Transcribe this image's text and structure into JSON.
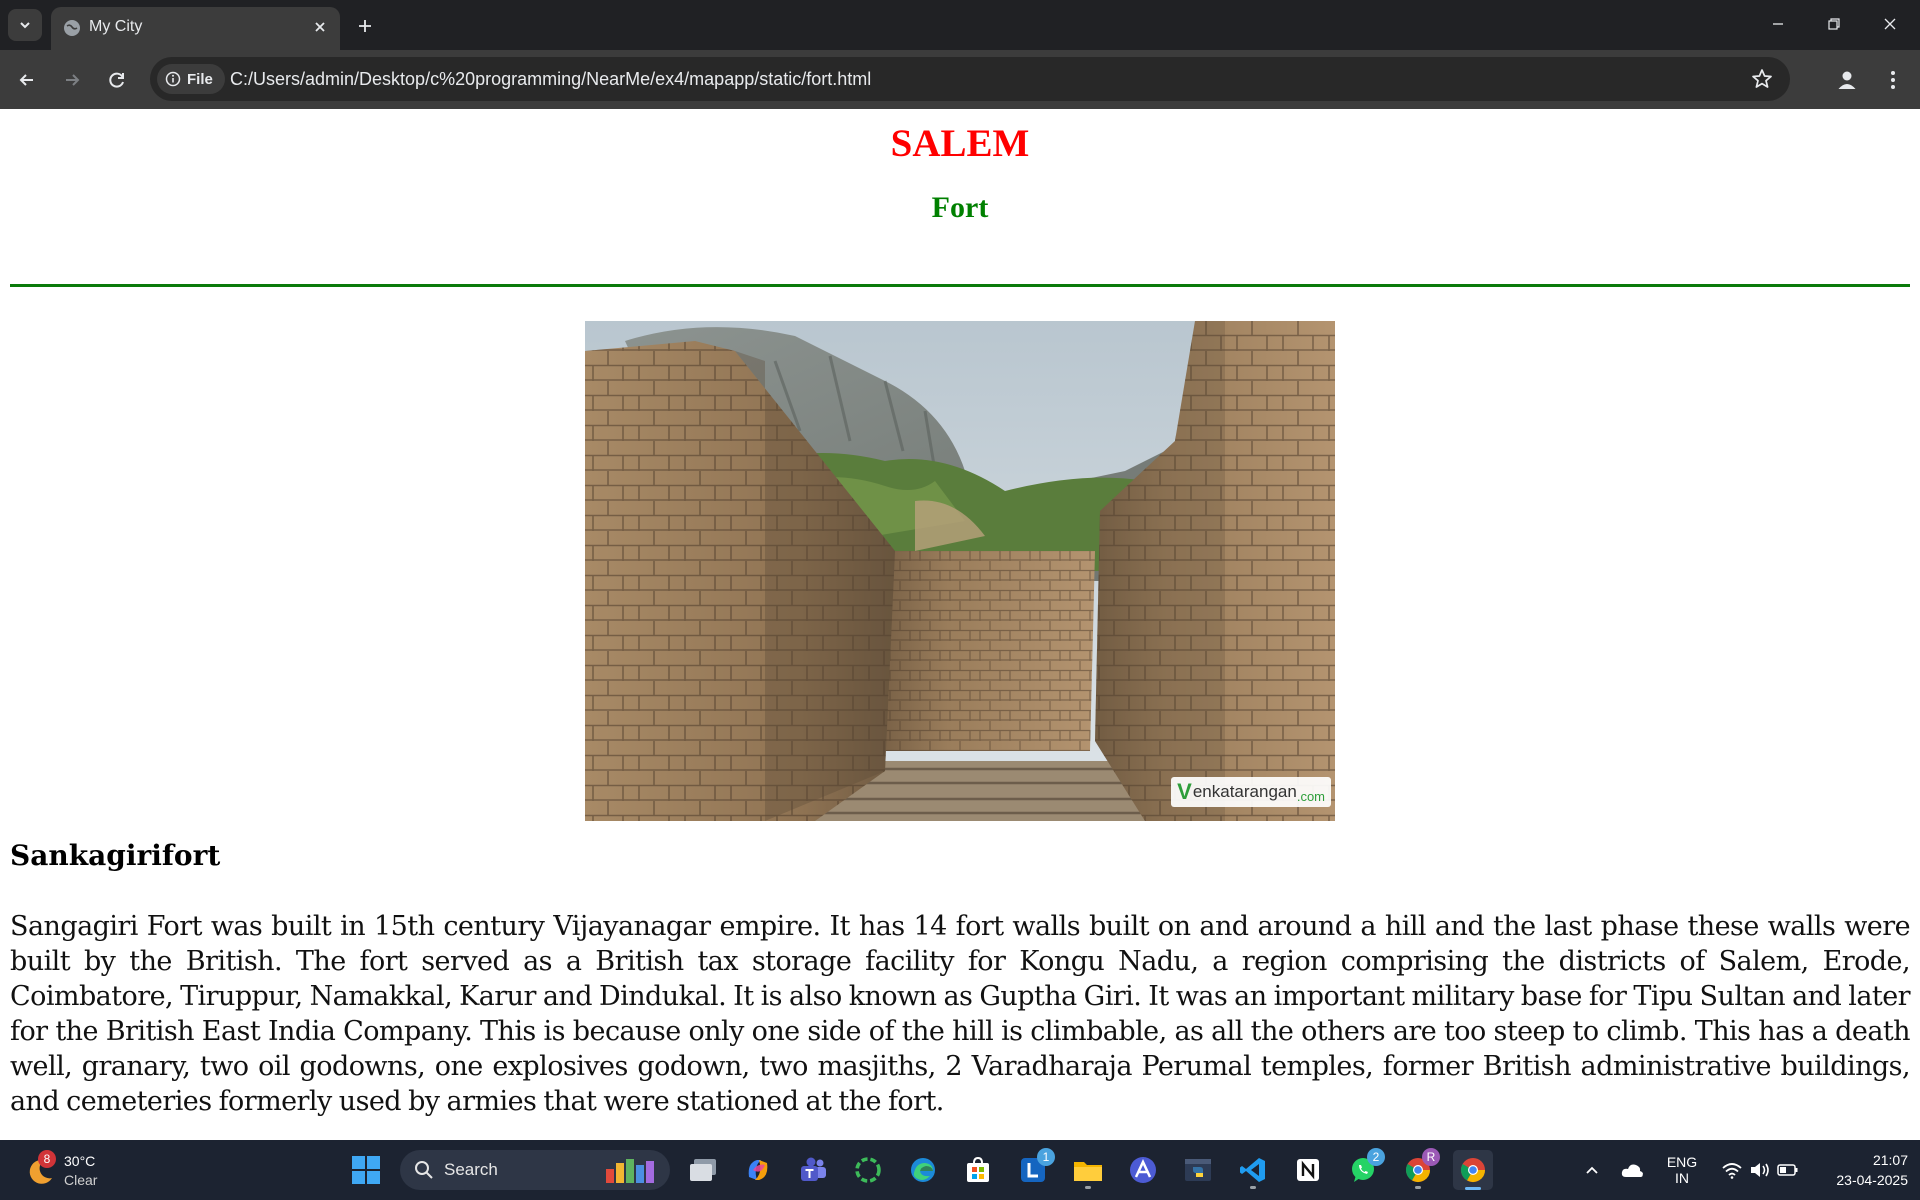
{
  "browser": {
    "tab_title": "My City",
    "url_scheme_chip": "File",
    "url": "C:/Users/admin/Desktop/c%20programming/NearMe/ex4/mapapp/static/fort.html"
  },
  "page": {
    "city": "SALEM",
    "place": "Fort",
    "image_watermark_prefix": "V",
    "image_watermark_text": "enkatarangan",
    "image_watermark_suffix": ".com",
    "heading": "Sankagirifort",
    "paragraph": "Sangagiri Fort was built in 15th century Vijayanagar empire. It has 14 fort walls built on and around a hill and the last phase these walls were built by the British. The fort served as a British tax storage facility for Kongu Nadu, a region comprising the districts of Salem, Erode, Coimbatore, Tiruppur, Namakkal, Karur and Dindukal. It is also known as Guptha Giri. It was an important military base for Tipu Sultan and later for the British East India Company. This is because only one side of the hill is climbable, as all the others are too steep to climb. This has a death well, granary, two oil godowns, one explosives godown, two masjiths, 2 Varadharaja Perumal temples, former British administrative buildings, and cemeteries formerly used by armies that were stationed at the fort."
  },
  "taskbar": {
    "weather_badge": "8",
    "weather_temp": "30°C",
    "weather_desc": "Clear",
    "search_label": "Search",
    "lens_badge": "1",
    "whatsapp_badge": "2",
    "profile_badge": "R",
    "lang_top": "ENG",
    "lang_bottom": "IN",
    "time": "21:07",
    "date": "23-04-2025"
  },
  "colors": {
    "city_title": "#ff0000",
    "place_title": "#008000",
    "rule": "#0a7a0a",
    "chrome_dark": "#202124",
    "taskbar": "#1c2331"
  }
}
